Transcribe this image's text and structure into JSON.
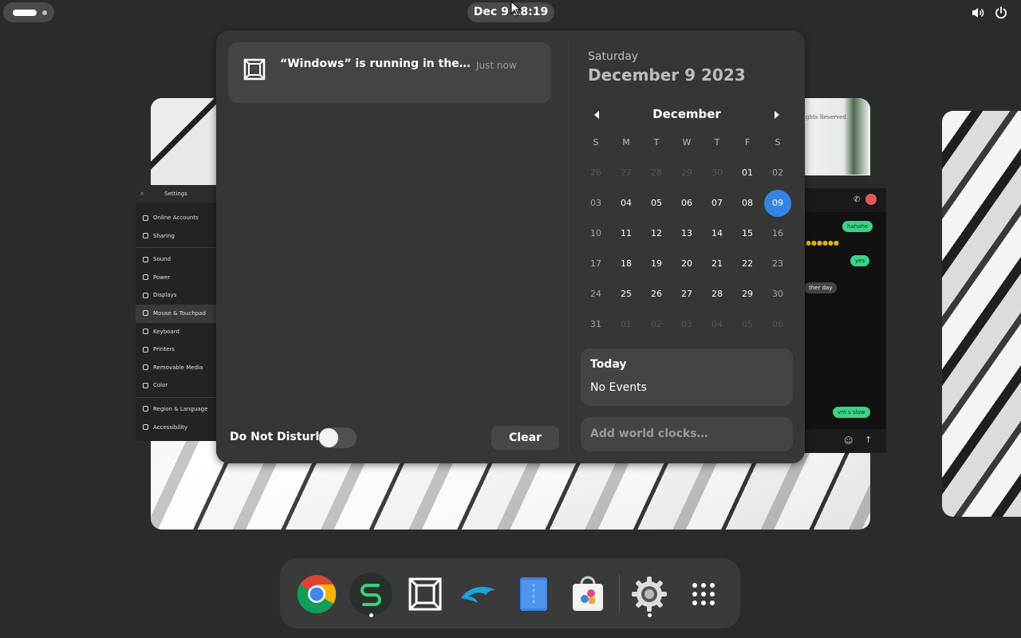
{
  "topbar": {
    "clock": "Dec 9  18:19",
    "activities_icon": "activities-indicator",
    "volume_icon": "volume-icon",
    "power_icon": "power-icon"
  },
  "notification": {
    "app_icon": "app-tile-icon",
    "title": "“Windows” is running in the bac…",
    "time": "Just now"
  },
  "do_not_disturb": {
    "label": "Do Not Disturb",
    "enabled": false
  },
  "clear_label": "Clear",
  "date_header": {
    "day": "Saturday",
    "date": "December 9 2023"
  },
  "calendar": {
    "month": "December",
    "weekday_headers": [
      "S",
      "M",
      "T",
      "W",
      "T",
      "F",
      "S"
    ],
    "weeks": [
      [
        "26",
        "27",
        "28",
        "29",
        "30",
        "01",
        "02"
      ],
      [
        "03",
        "04",
        "05",
        "06",
        "07",
        "08",
        "09"
      ],
      [
        "10",
        "11",
        "12",
        "13",
        "14",
        "15",
        "16"
      ],
      [
        "17",
        "18",
        "19",
        "20",
        "21",
        "22",
        "23"
      ],
      [
        "24",
        "25",
        "26",
        "27",
        "28",
        "29",
        "30"
      ],
      [
        "31",
        "01",
        "02",
        "03",
        "04",
        "05",
        "06"
      ]
    ],
    "selected": "09"
  },
  "events": {
    "title": "Today",
    "empty": "No Events"
  },
  "world_clocks_label": "Add world clocks…",
  "settings_thumb": {
    "title": "Settings",
    "items": [
      "Online Accounts",
      "Sharing",
      "Sound",
      "Power",
      "Displays",
      "Mouse & Touchpad",
      "Keyboard",
      "Printers",
      "Removable Media",
      "Color",
      "Region & Language",
      "Accessibility"
    ]
  },
  "chat_thumb": {
    "messages": [
      "hahahe",
      "yes",
      "ther day",
      "vm s slow"
    ],
    "header_text": "ghts Reserved."
  },
  "dock": {
    "items": [
      "chrome-icon",
      "gitkraken-icon",
      "boxes-icon",
      "dolphin-icon",
      "files-icon",
      "software-icon",
      "settings-icon",
      "app-grid-icon"
    ]
  }
}
